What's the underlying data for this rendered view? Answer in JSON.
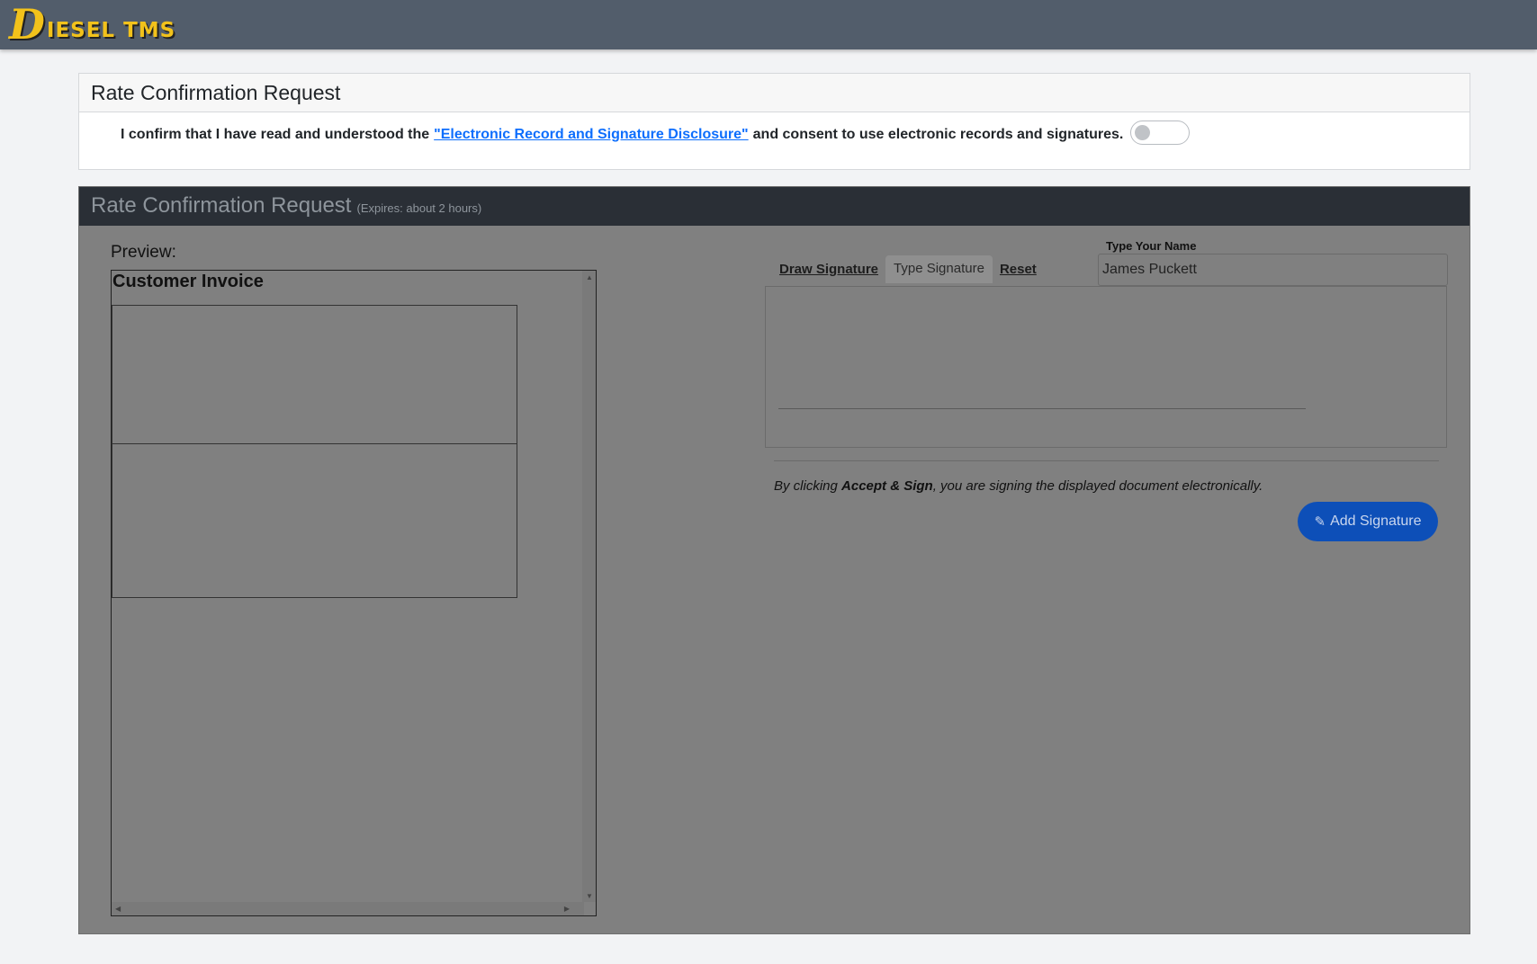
{
  "brand": {
    "logo_initial": "D",
    "logo_rest": "IESEL TMS"
  },
  "consent_card": {
    "title": "Rate Confirmation Request",
    "text_before": "I confirm that I have read and understood the",
    "link_text": "\"Electronic Record and Signature Disclosure\"",
    "text_after": "and consent to use electronic records and signatures.",
    "toggle_on": false
  },
  "sign_card": {
    "title": "Rate Confirmation Request",
    "expires": "(Expires: about 2 hours)",
    "preview_label": "Preview:",
    "document_title": "Customer Invoice",
    "tabs": [
      {
        "label": "Draw Signature",
        "active": false
      },
      {
        "label": "Type Signature",
        "active": true
      },
      {
        "label": "Reset",
        "active": false
      }
    ],
    "name_label": "Type Your Name",
    "name_value": "James Puckett",
    "legal_text_pre": "By clicking ",
    "legal_text_bold": "Accept & Sign",
    "legal_text_post": ", you are signing the displayed document electronically.",
    "add_signature_label": "Add Signature",
    "pen_icon": "pen-icon"
  },
  "colors": {
    "topbar": "#525d6b",
    "logo": "#f2c21b",
    "link": "#0d6efd",
    "primary_button": "#0d4fb8",
    "dark_header": "#2a2f36",
    "overlay_gray": "#808080"
  }
}
